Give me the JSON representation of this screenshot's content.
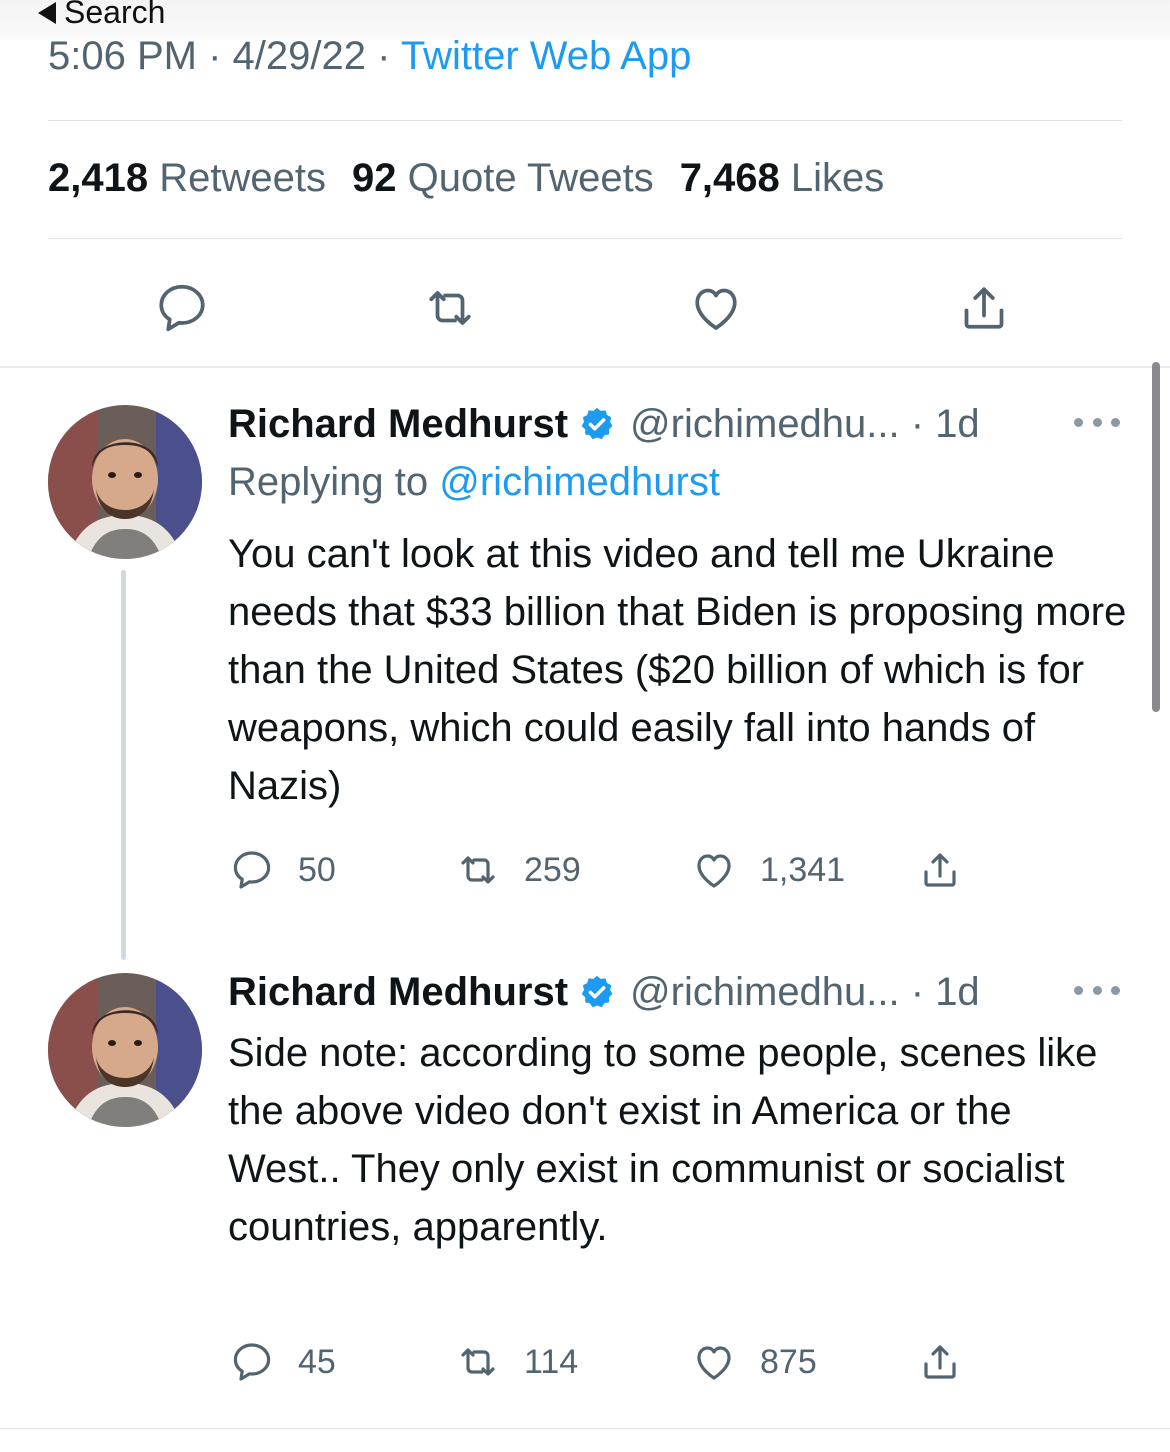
{
  "statusbar": {
    "back_label": "Search"
  },
  "tweet_meta": {
    "time": "5:06 PM",
    "date": "4/29/22",
    "source": "Twitter Web App"
  },
  "stats": {
    "retweets_count": "2,418",
    "retweets_label": "Retweets",
    "quotes_count": "92",
    "quotes_label": "Quote Tweets",
    "likes_count": "7,468",
    "likes_label": "Likes"
  },
  "actions": [
    "reply-icon",
    "retweet-icon",
    "like-icon",
    "share-icon"
  ],
  "colors": {
    "accent": "#1d9bf0",
    "secondary_text": "#536471",
    "verified": "#1d9bf0"
  },
  "replies": [
    {
      "name": "Richard Medhurst",
      "handle": "@richimedhu...",
      "time": "1d",
      "replying_prefix": "Replying to",
      "replying_handle": "@richimedhurst",
      "text": "You can't look at this video and tell me Ukraine needs that $33 billion that Biden is proposing more than the United States ($20 billion of which is for weapons, which could easily fall into hands of Nazis)",
      "reply_count": "50",
      "retweet_count": "259",
      "like_count": "1,341"
    },
    {
      "name": "Richard Medhurst",
      "handle": "@richimedhu...",
      "time": "1d",
      "text": "Side note: according to some people, scenes like the above video don't exist in America or the West.. They only exist in communist or socialist countries, apparently.",
      "reply_count": "45",
      "retweet_count": "114",
      "like_count": "875"
    }
  ]
}
